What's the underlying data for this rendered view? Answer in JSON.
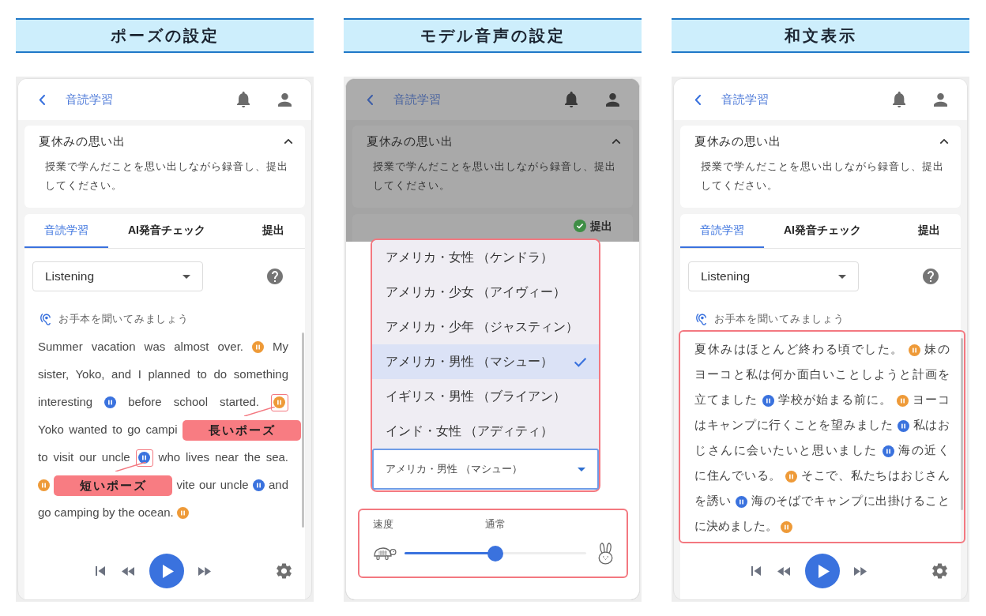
{
  "panels": [
    {
      "kind": "reading",
      "heading": "ポーズの設定",
      "app_bar": {
        "title": "音読学習"
      },
      "assignment": {
        "title": "夏休みの思い出",
        "description": "授業で学んだことを思い出しながら録音し、提出してください。",
        "expanded": true
      },
      "tabs": [
        {
          "label": "音読学習",
          "selected": true,
          "done": false
        },
        {
          "label": "AI発音チェック",
          "selected": false,
          "done": false
        },
        {
          "label": "提出",
          "selected": false,
          "done": false
        }
      ],
      "mode_select": {
        "value": "Listening"
      },
      "instruction": "お手本を聞いてみましょう",
      "passage": {
        "framed": false,
        "lines": [
          [
            {
              "kind": "text",
              "text": "Summer vacation was almost over."
            },
            {
              "kind": "long_pause",
              "highlighted": false
            },
            {
              "kind": "text",
              "text": "My"
            }
          ],
          [
            {
              "kind": "text",
              "text": "sister, Yoko, and I planned to do something"
            }
          ],
          [
            {
              "kind": "text",
              "text": "interesting"
            },
            {
              "kind": "short_pause",
              "highlighted": false
            },
            {
              "kind": "text",
              "text": "before school started."
            },
            {
              "kind": "long_pause",
              "highlighted": true
            }
          ],
          [
            {
              "kind": "text",
              "text": "Yoko wanted to go campi"
            },
            {
              "kind": "callout",
              "text": "長いポーズ"
            }
          ],
          [
            {
              "kind": "text",
              "text": "to visit our uncle"
            },
            {
              "kind": "short_pause",
              "highlighted": true
            },
            {
              "kind": "text",
              "text": "who lives near the sea."
            }
          ],
          [
            {
              "kind": "long_pause",
              "highlighted": false
            },
            {
              "kind": "callout",
              "text": "短いポーズ"
            },
            {
              "kind": "text",
              "text": "vite our uncle"
            },
            {
              "kind": "short_pause",
              "highlighted": false
            },
            {
              "kind": "text",
              "text": "and"
            }
          ],
          [
            {
              "kind": "text",
              "text": "go camping by the ocean."
            },
            {
              "kind": "long_pause",
              "highlighted": false
            }
          ]
        ]
      }
    },
    {
      "kind": "voice_settings",
      "heading": "モデル音声の設定",
      "app_bar": {
        "title": "音読学習"
      },
      "assignment": {
        "title": "夏休みの思い出",
        "description": "授業で学んだことを思い出しながら録音し、提出してください。",
        "expanded": true
      },
      "tabs": [
        {
          "label": "提出",
          "selected": false,
          "done": true
        }
      ],
      "voice_menu": {
        "framed": true,
        "options": [
          {
            "label": "アメリカ・女性 （ケンドラ）",
            "selected": false
          },
          {
            "label": "アメリカ・少女 （アイヴィー）",
            "selected": false
          },
          {
            "label": "アメリカ・少年 （ジャスティン）",
            "selected": false
          },
          {
            "label": "アメリカ・男性 （マシュー）",
            "selected": true
          },
          {
            "label": "イギリス・男性 （ブライアン）",
            "selected": false
          },
          {
            "label": "インド・女性 （アディティ）",
            "selected": false
          }
        ],
        "value": "アメリカ・男性 （マシュー）"
      },
      "speed": {
        "framed": true,
        "label": "速度",
        "reading": "通常",
        "level": 0.5
      }
    },
    {
      "kind": "reading",
      "heading": "和文表示",
      "app_bar": {
        "title": "音読学習"
      },
      "assignment": {
        "title": "夏休みの思い出",
        "description": "授業で学んだことを思い出しながら録音し、提出してください。",
        "expanded": true
      },
      "tabs": [
        {
          "label": "音読学習",
          "selected": true,
          "done": false
        },
        {
          "label": "AI発音チェック",
          "selected": false,
          "done": false
        },
        {
          "label": "提出",
          "selected": false,
          "done": false
        }
      ],
      "mode_select": {
        "value": "Listening"
      },
      "instruction": "お手本を聞いてみましょう",
      "passage": {
        "framed": true,
        "lines": [
          [
            {
              "kind": "text",
              "text": "夏休みはほとんど終わる頃でした。"
            },
            {
              "kind": "long_pause",
              "highlighted": false
            },
            {
              "kind": "text",
              "text": "妹の"
            }
          ],
          [
            {
              "kind": "text",
              "text": "ヨーコと私は何か面白いことしようと計画を"
            }
          ],
          [
            {
              "kind": "text",
              "text": "立てました"
            },
            {
              "kind": "short_pause",
              "highlighted": false
            },
            {
              "kind": "text",
              "text": "学校が始まる前に。"
            },
            {
              "kind": "long_pause",
              "highlighted": false
            },
            {
              "kind": "text",
              "text": "ヨーコ"
            }
          ],
          [
            {
              "kind": "text",
              "text": "はキャンプに行くことを望みました"
            },
            {
              "kind": "short_pause",
              "highlighted": false
            },
            {
              "kind": "text",
              "text": "私はお"
            }
          ],
          [
            {
              "kind": "text",
              "text": "じさんに会いたいと思いました"
            },
            {
              "kind": "short_pause",
              "highlighted": false
            },
            {
              "kind": "text",
              "text": "海の近く"
            }
          ],
          [
            {
              "kind": "text",
              "text": "に住んでいる。"
            },
            {
              "kind": "long_pause",
              "highlighted": false
            },
            {
              "kind": "text",
              "text": "そこで、私たちはおじさん"
            }
          ],
          [
            {
              "kind": "text",
              "text": "を誘い"
            },
            {
              "kind": "short_pause",
              "highlighted": false
            },
            {
              "kind": "text",
              "text": "海のそばでキャンプに出掛けること"
            }
          ],
          [
            {
              "kind": "text",
              "text": "に決めました。"
            },
            {
              "kind": "long_pause",
              "highlighted": false
            }
          ]
        ]
      }
    }
  ]
}
